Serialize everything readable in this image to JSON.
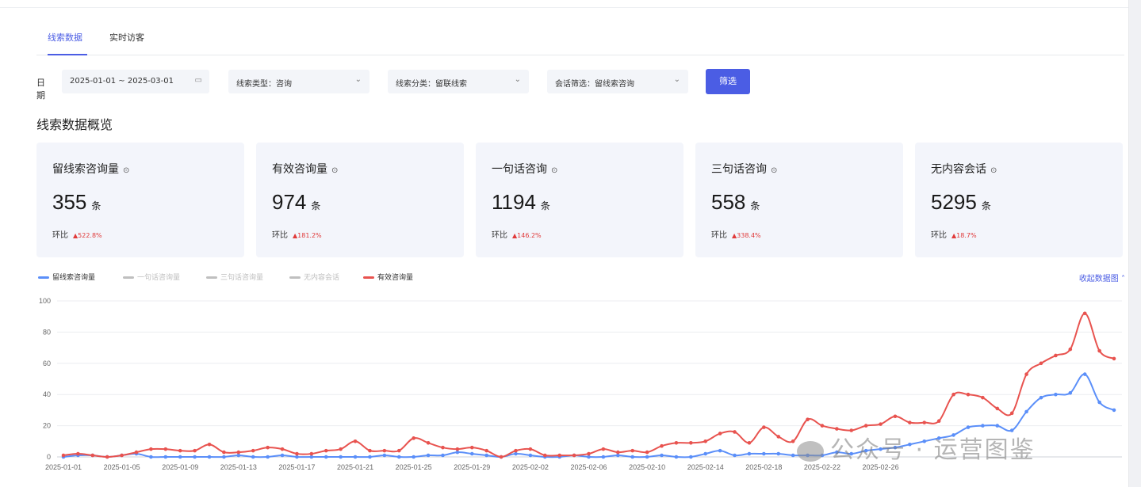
{
  "tabs": [
    {
      "label": "线索数据",
      "active": true
    },
    {
      "label": "实时访客",
      "active": false
    }
  ],
  "filters": {
    "date_label": "日期",
    "date_range": "2025-01-01 ~ 2025-03-01",
    "lead_type": "线索类型：咨询",
    "lead_category": "线索分类：留联线索",
    "session_filter": "会话筛选：留线索咨询",
    "submit_label": "筛选"
  },
  "overview": {
    "title": "线索数据概览",
    "compare_label": "环比",
    "unit": "条",
    "cards": [
      {
        "title": "留线索咨询量",
        "value": "355",
        "change": "▲522.8%"
      },
      {
        "title": "有效咨询量",
        "value": "974",
        "change": "▲181.2%"
      },
      {
        "title": "一句话咨询",
        "value": "1194",
        "change": "▲146.2%"
      },
      {
        "title": "三句话咨询",
        "value": "558",
        "change": "▲338.4%"
      },
      {
        "title": "无内容会话",
        "value": "5295",
        "change": "▲18.7%"
      }
    ]
  },
  "collapse_label": "收起数据图",
  "watermark": "公众号 · 运营图鉴",
  "colors": {
    "accent": "#4b5de4",
    "blue_series": "#5b8ff9",
    "red_series": "#e8534f",
    "disabled": "#bfbfbf",
    "up": "#e03a3a"
  },
  "chart_data": {
    "type": "line",
    "legend": [
      {
        "name": "留线索咨询量",
        "color": "#5b8ff9",
        "active": true
      },
      {
        "name": "一句话咨询量",
        "color": "#bfbfbf",
        "active": false
      },
      {
        "name": "三句话咨询量",
        "color": "#bfbfbf",
        "active": false
      },
      {
        "name": "无内容会话",
        "color": "#bfbfbf",
        "active": false
      },
      {
        "name": "有效咨询量",
        "color": "#e8534f",
        "active": true
      }
    ],
    "ylim": [
      0,
      100
    ],
    "yticks": [
      0,
      20,
      40,
      60,
      80,
      100
    ],
    "x_start": "2025-01-01",
    "x_labels": [
      "2025-01-01",
      "2025-01-05",
      "2025-01-09",
      "2025-01-13",
      "2025-01-17",
      "2025-01-21",
      "2025-01-25",
      "2025-01-29",
      "2025-02-02",
      "2025-02-06",
      "2025-02-10",
      "2025-02-14",
      "2025-02-18",
      "2025-02-22",
      "2025-02-26"
    ],
    "series": [
      {
        "name": "留线索咨询量",
        "color": "#5b8ff9",
        "values": [
          0,
          1,
          1,
          0,
          1,
          2,
          0,
          0,
          0,
          0,
          0,
          0,
          1,
          0,
          0,
          1,
          0,
          0,
          0,
          0,
          0,
          0,
          1,
          0,
          0,
          1,
          1,
          3,
          2,
          1,
          0,
          2,
          1,
          0,
          0,
          1,
          0,
          0,
          1,
          0,
          0,
          1,
          0,
          0,
          2,
          4,
          1,
          2,
          2,
          2,
          1,
          1,
          1,
          3,
          2,
          4,
          5,
          6,
          8,
          10,
          12,
          14,
          19,
          20,
          20,
          17,
          29,
          38,
          40,
          41,
          53,
          35,
          30
        ]
      },
      {
        "name": "有效咨询量",
        "color": "#e8534f",
        "values": [
          1,
          2,
          1,
          0,
          1,
          3,
          5,
          5,
          4,
          4,
          8,
          3,
          3,
          4,
          6,
          5,
          2,
          2,
          4,
          5,
          10,
          4,
          4,
          4,
          12,
          9,
          6,
          5,
          6,
          4,
          0,
          4,
          5,
          1,
          1,
          1,
          2,
          5,
          3,
          4,
          3,
          7,
          9,
          9,
          10,
          15,
          16,
          9,
          19,
          13,
          10,
          24,
          20,
          18,
          17,
          20,
          21,
          26,
          22,
          22,
          23,
          40,
          40,
          38,
          31,
          28,
          53,
          60,
          65,
          69,
          92,
          68,
          63
        ]
      }
    ]
  }
}
